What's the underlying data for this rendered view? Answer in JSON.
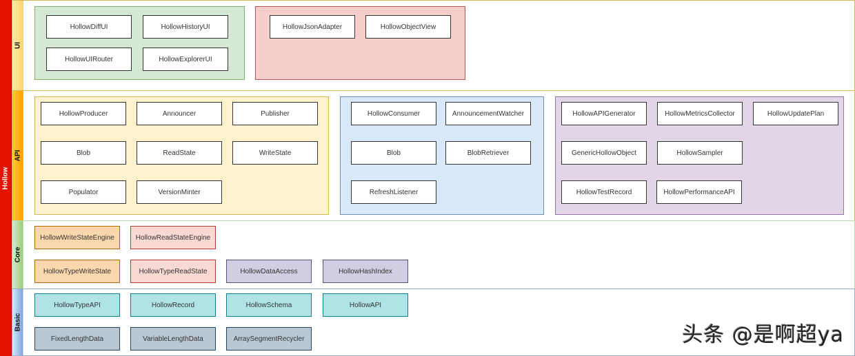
{
  "root": {
    "label": "Hollow"
  },
  "layers": {
    "ui": {
      "label": "UI",
      "groups": [
        {
          "items": [
            "HollowDiffUI",
            "HollowHistoryUI",
            "HollowUIRouter",
            "HollowExplorerUI"
          ]
        },
        {
          "items": [
            "HollowJsonAdapter",
            "HollowObjectView"
          ]
        }
      ]
    },
    "api": {
      "label": "API",
      "groups": [
        {
          "items": [
            "HollowProducer",
            "Announcer",
            "Publisher",
            "Blob",
            "ReadState",
            "WriteState",
            "Populator",
            "VersionMinter"
          ]
        },
        {
          "items": [
            "HollowConsumer",
            "AnnouncementWatcher",
            "Blob",
            "BlobRetriever",
            "RefreshListener"
          ]
        },
        {
          "items": [
            "HollowAPIGenerator",
            "HollowMetricsCollector",
            "HollowUpdatePlan",
            "GenericHollowObject",
            "HollowSampler",
            "HollowTestRecord",
            "HollowPerformanceAPI"
          ]
        }
      ]
    },
    "core": {
      "label": "Core",
      "items": [
        "HollowWriteStateEngine",
        "HollowReadStateEngine",
        "HollowTypeWriteState",
        "HollowTypeReadState",
        "HollowDataAccess",
        "HollowHashIndex"
      ]
    },
    "basic": {
      "label": "Basic",
      "items": [
        "HollowTypeAPI",
        "HollowRecord",
        "HollowSchema",
        "HollowAPI",
        "FixedLengthData",
        "VariableLengthData",
        "ArraySegmentRecycler"
      ]
    }
  },
  "colors": {
    "root": "#e51400",
    "ui_group_1": "#d5e8d4",
    "ui_group_2": "#f8cecc",
    "api_group_1": "#fff2cc",
    "api_group_2": "#dae8fc",
    "api_group_3": "#e1d5e7",
    "core_write": "#fad7ac",
    "core_read": "#fad9d5",
    "core_access": "#d0cee2",
    "basic_api": "#b0e3e6",
    "basic_data": "#bac8d3"
  },
  "watermark": "头条 @是啊超ya"
}
